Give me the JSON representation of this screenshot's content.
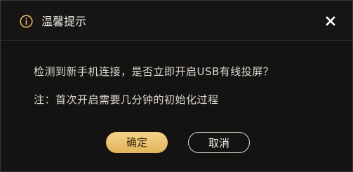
{
  "dialog": {
    "title": "温馨提示",
    "message": "检测到新手机连接，是否立即开启USB有线投屏？",
    "note": "注：首次开启需要几分钟的初始化过程",
    "ok_label": "确定",
    "cancel_label": "取消",
    "icons": {
      "info": "info-circle-icon",
      "close": "close-icon"
    },
    "colors": {
      "accent": "#e8b960",
      "ok_button_top": "#f3d389",
      "ok_button_bottom": "#e3b35c",
      "background": "#141312",
      "text": "#dcd8d3"
    }
  }
}
